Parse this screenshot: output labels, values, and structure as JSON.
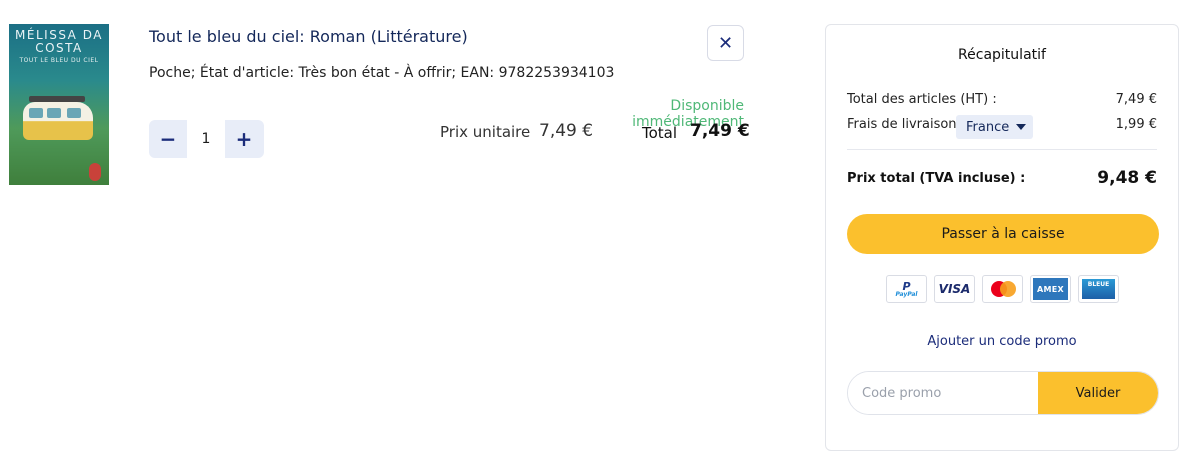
{
  "item": {
    "cover": {
      "author": "MÉLISSA DA COSTA",
      "subtitle": "TOUT LE BLEU DU CIEL"
    },
    "title": "Tout le bleu du ciel: Roman (Littérature)",
    "details": "Poche; État d'article: Très bon état - À offrir; EAN: 9782253934103",
    "availability": "Disponible immédiatement",
    "unit_price_label": "Prix unitaire",
    "unit_price": "7,49 €",
    "total_label": "Total",
    "total_price": "7,49 €",
    "quantity": "1",
    "decrement_symbol": "−",
    "increment_symbol": "+",
    "remove_symbol": "✕"
  },
  "summary": {
    "heading": "Récapitulatif",
    "items_total_label": "Total des articles (HT) :",
    "items_total_value": "7,49 €",
    "shipping_label": "Frais de livraison",
    "shipping_country": "France",
    "shipping_value": "1,99 €",
    "grand_total_label": "Prix total (TVA incluse) :",
    "grand_total_value": "9,48 €",
    "checkout_label": "Passer à la caisse",
    "payment_methods": {
      "paypal_top": "PayPal",
      "visa": "VISA",
      "amex": "AMEX",
      "cb": "BLEUE"
    },
    "promo_link": "Ajouter un code promo",
    "promo_placeholder": "Code promo",
    "promo_submit": "Valider"
  },
  "colors": {
    "accent_yellow": "#fbc02d",
    "navy": "#14285a",
    "available_green": "#4fb877"
  }
}
